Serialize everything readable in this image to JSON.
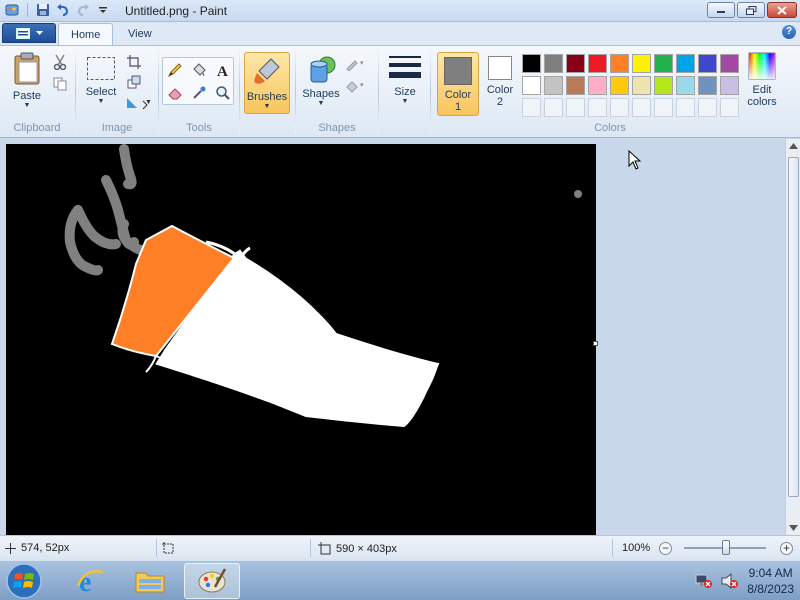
{
  "window": {
    "title": "Untitled.png - Paint"
  },
  "tabs": [
    {
      "label": "Home"
    },
    {
      "label": "View"
    }
  ],
  "help_label": "?",
  "ribbon": {
    "clipboard": {
      "paste_label": "Paste",
      "group_label": "Clipboard"
    },
    "image": {
      "select_label": "Select",
      "group_label": "Image"
    },
    "tools": {
      "group_label": "Tools"
    },
    "brushes": {
      "label": "Brushes"
    },
    "shapes": {
      "shapes_label": "Shapes",
      "group_label": "Shapes"
    },
    "size": {
      "label": "Size"
    },
    "colors": {
      "color1_label": "Color\n1",
      "color2_label": "Color\n2",
      "edit_label": "Edit\ncolors",
      "group_label": "Colors",
      "color1_value": "#7f7f7f",
      "color2_value": "#ffffff",
      "palette_row1": [
        "#000000",
        "#7f7f7f",
        "#880015",
        "#ed1c24",
        "#ff7f27",
        "#fff200",
        "#22b14c",
        "#00a2e8",
        "#3f48cc",
        "#a349a4"
      ],
      "palette_row2": [
        "#ffffff",
        "#c3c3c3",
        "#b97a57",
        "#ffaec9",
        "#ffc90e",
        "#efe4b0",
        "#b5e61d",
        "#99d9ea",
        "#7092be",
        "#c8bfe7"
      ]
    }
  },
  "status": {
    "cursor_pos": "574, 52px",
    "image_size": "590 × 403px",
    "zoom": "100%",
    "zoom_minus": "−",
    "zoom_plus": "+"
  },
  "taskbar": {
    "time": "9:04 AM",
    "date": "8/8/2023",
    "apps": [
      "internet-explorer",
      "file-explorer",
      "paint"
    ]
  },
  "drawing": {
    "background": "#000000",
    "steam_color": "#808080",
    "flame_color": "#ff7f27",
    "paper_color": "#ffffff"
  }
}
